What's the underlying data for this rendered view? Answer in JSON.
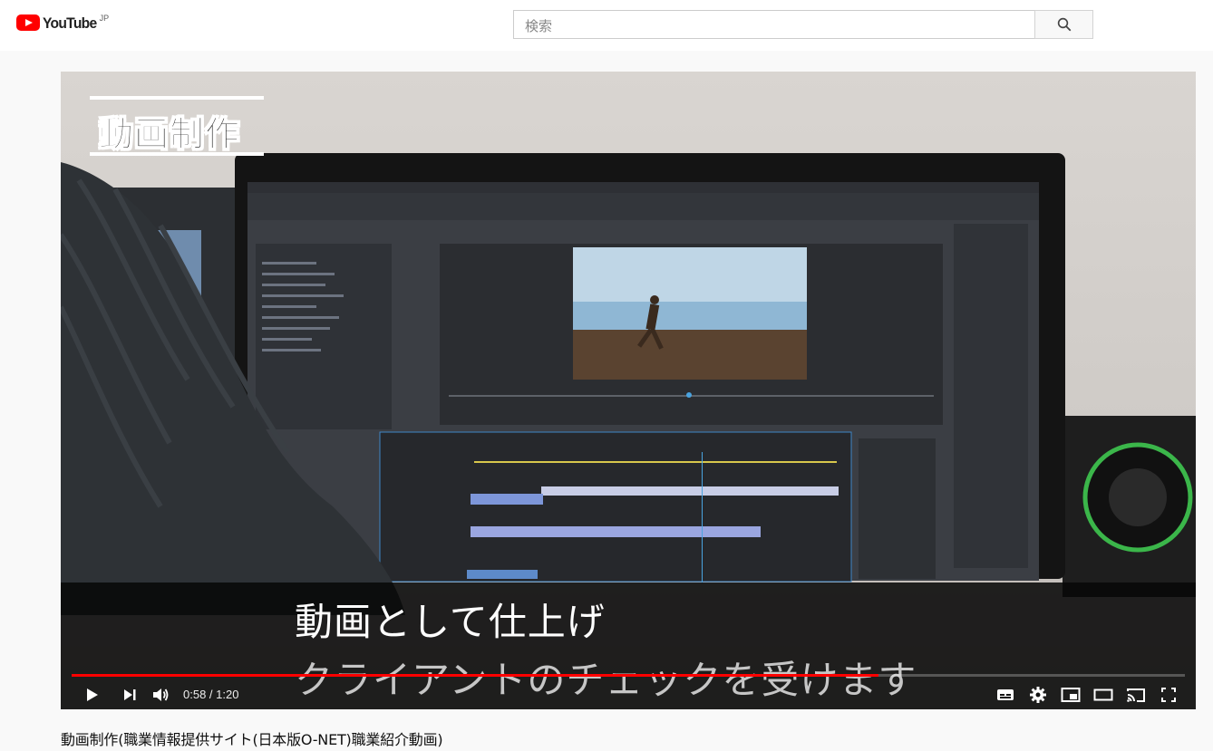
{
  "masthead": {
    "logo_text": "YouTube",
    "country_code": "JP",
    "search": {
      "placeholder": "検索"
    },
    "search_button_icon": "search-icon"
  },
  "video": {
    "title_card": "動画制作",
    "subtitle_lines": [
      "動画として仕上げ",
      "クライアントのチェックを受けます"
    ],
    "progress_fraction": 0.725,
    "current_time": "0:58",
    "duration": "1:20",
    "time_display": "0:58 / 1:20",
    "controls": {
      "left": [
        "play-icon",
        "next-icon",
        "volume-icon"
      ],
      "right": [
        "subtitles-icon",
        "settings-icon",
        "miniplayer-icon",
        "theater-mode-icon",
        "cast-icon",
        "fullscreen-icon"
      ]
    }
  },
  "video_title": "動画制作(職業情報提供サイト(日本版O-NET)職業紹介動画)",
  "colors": {
    "brand_red": "#ff0000",
    "progress_played": "#ff0000"
  }
}
